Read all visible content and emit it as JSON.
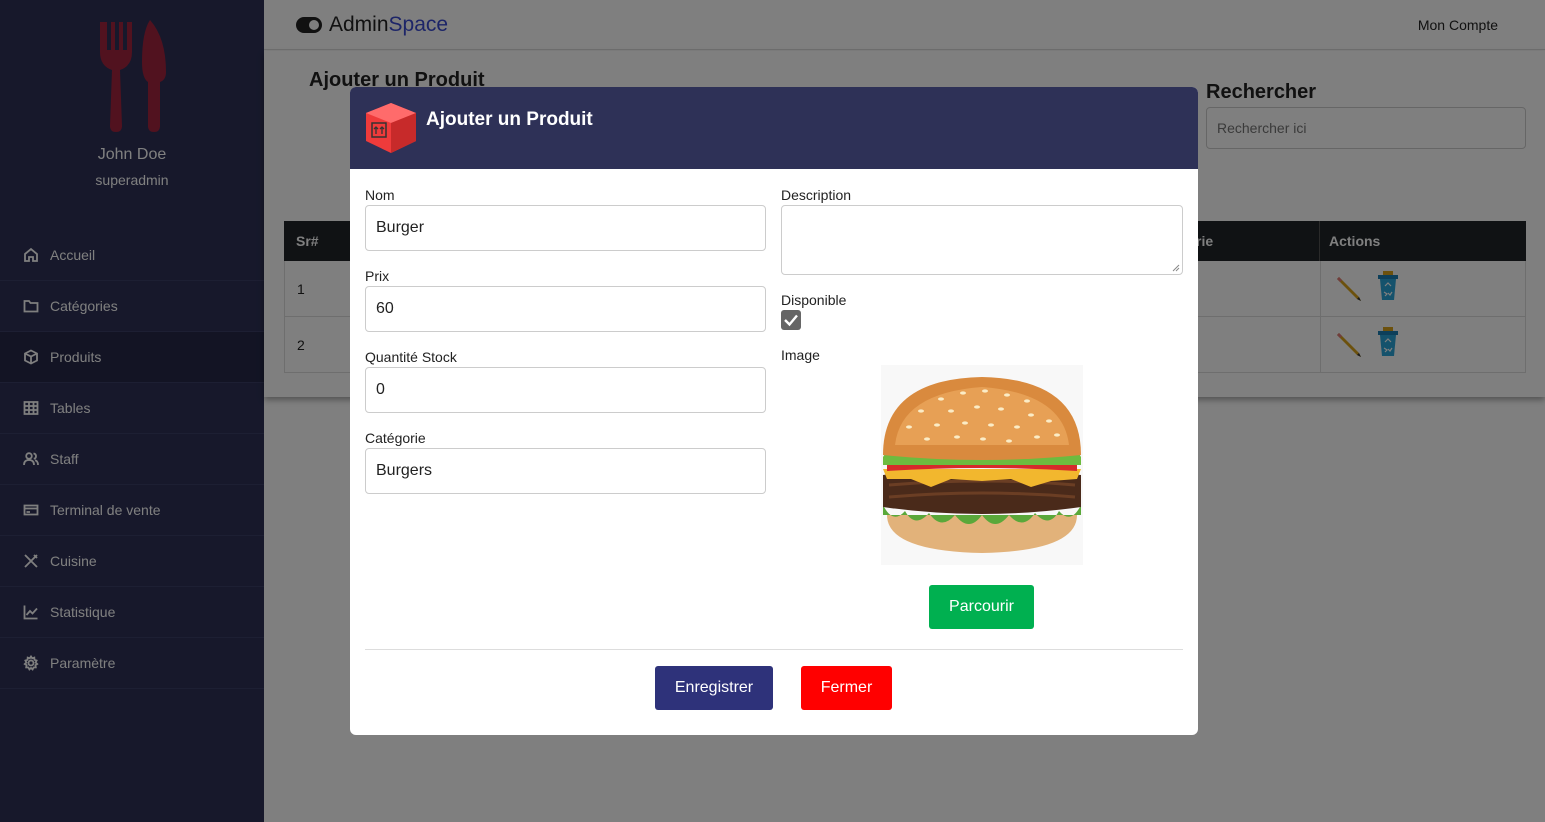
{
  "sidebar": {
    "user_name": "John Doe",
    "user_role": "superadmin",
    "items": [
      {
        "label": "Accueil",
        "icon": "home-icon"
      },
      {
        "label": "Catégories",
        "icon": "folder-icon"
      },
      {
        "label": "Produits",
        "icon": "box-icon",
        "active": true
      },
      {
        "label": "Tables",
        "icon": "table-icon"
      },
      {
        "label": "Staff",
        "icon": "users-icon"
      },
      {
        "label": "Terminal de vente",
        "icon": "credit-card-icon"
      },
      {
        "label": "Cuisine",
        "icon": "utensils-icon"
      },
      {
        "label": "Statistique",
        "icon": "chart-icon"
      },
      {
        "label": "Paramètre",
        "icon": "gear-icon"
      }
    ]
  },
  "topbar": {
    "brand_part1": "Admin",
    "brand_part2": "Space",
    "account": "Mon Compte"
  },
  "page": {
    "title": "Ajouter un Produit",
    "search_label": "Rechercher",
    "search_placeholder": "Rechercher ici",
    "table": {
      "col_sr": "Sr#",
      "col_category_partial": "rie",
      "col_actions": "Actions",
      "rows": [
        {
          "sr": "1"
        },
        {
          "sr": "2"
        }
      ]
    }
  },
  "modal": {
    "title": "Ajouter un Produit",
    "fields": {
      "nom_label": "Nom",
      "nom_value": "Burger",
      "prix_label": "Prix",
      "prix_value": "60",
      "stock_label": "Quantité Stock",
      "stock_value": "0",
      "categorie_label": "Catégorie",
      "categorie_value": "Burgers",
      "description_label": "Description",
      "description_value": "",
      "disponible_label": "Disponible",
      "disponible_checked": true,
      "image_label": "Image"
    },
    "buttons": {
      "browse": "Parcourir",
      "save": "Enregistrer",
      "close": "Fermer"
    }
  },
  "colors": {
    "sidebar": "#2e3157",
    "brand_accent": "#3a4bd1",
    "save_button": "#2e327a",
    "close_button": "#ff0000",
    "browse_button": "#00b050"
  }
}
